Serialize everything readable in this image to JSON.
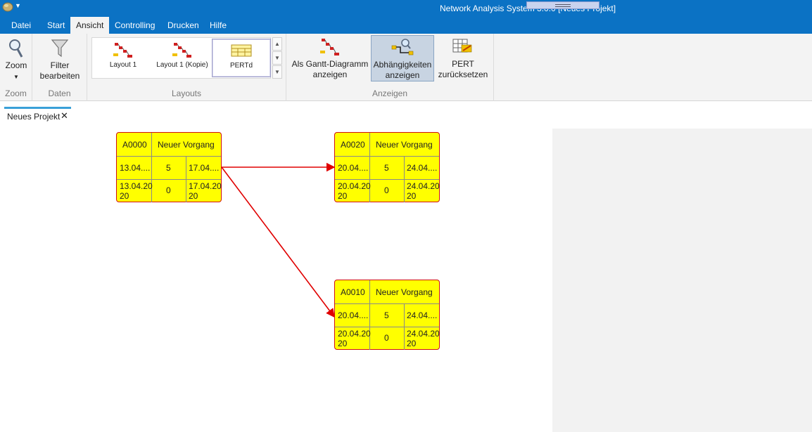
{
  "window": {
    "title": "Network Analysis System 3.0.0 [Neues Projekt]"
  },
  "tabs": [
    "Datei",
    "Start",
    "Ansicht",
    "Controlling",
    "Drucken",
    "Hilfe"
  ],
  "ribbon": {
    "zoom": {
      "label": "Zoom",
      "group": "Zoom"
    },
    "daten": {
      "filter_label_1": "Filter",
      "filter_label_2": "bearbeiten",
      "group": "Daten"
    },
    "layouts": {
      "items": [
        "Layout 1",
        "Layout 1 (Kopie)",
        "PERTd"
      ],
      "group": "Layouts"
    },
    "anzeigen": {
      "gantt_1": "Als Gantt-Diagramm",
      "gantt_2": "anzeigen",
      "dep_1": "Abhängigkeiten",
      "dep_2": "anzeigen",
      "pert_1": "PERT",
      "pert_2": "zurücksetzen",
      "group": "Anzeigen"
    }
  },
  "document": {
    "tab_label": "Neues Projekt",
    "close_glyph": "✕"
  },
  "nodes": [
    {
      "id": "A0000",
      "name": "Neuer Vorgang",
      "r1": [
        "13.04....",
        "5",
        "17.04...."
      ],
      "r2a": [
        "13.04.20",
        "0",
        "17.04.20"
      ],
      "r2b": [
        "20",
        "20"
      ]
    },
    {
      "id": "A0020",
      "name": "Neuer Vorgang",
      "r1": [
        "20.04....",
        "5",
        "24.04...."
      ],
      "r2a": [
        "20.04.20",
        "0",
        "24.04.20"
      ],
      "r2b": [
        "20",
        "20"
      ]
    },
    {
      "id": "A0010",
      "name": "Neuer Vorgang",
      "r1": [
        "20.04....",
        "5",
        "24.04...."
      ],
      "r2a": [
        "20.04.20",
        "0",
        "24.04.20"
      ],
      "r2b": [
        "20",
        "20"
      ]
    }
  ],
  "colors": {
    "accent": "#0b72c4",
    "node_fill": "#ffff00",
    "edge": "#e00000"
  }
}
